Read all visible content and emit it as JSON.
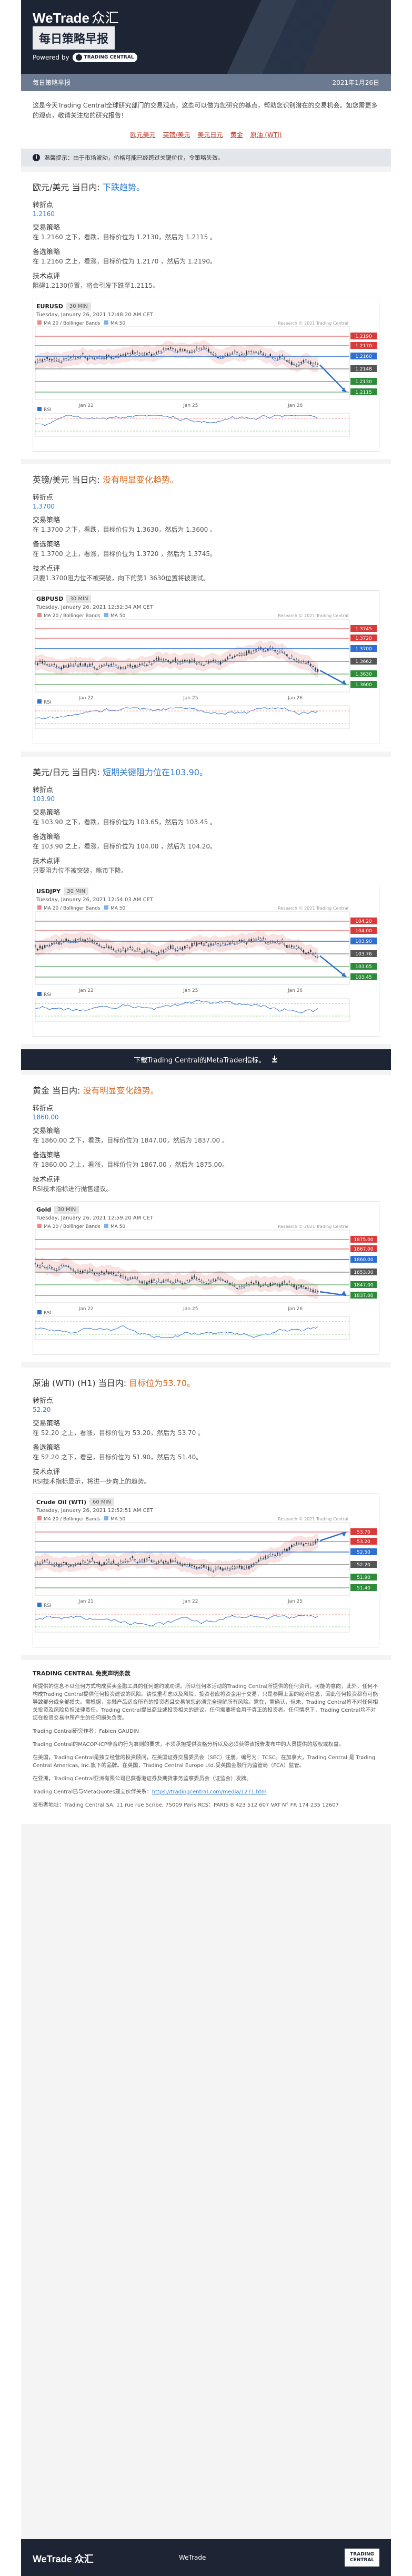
{
  "header": {
    "brand": "WeTrade",
    "brand_zh": "众汇",
    "title": "每日策略早报",
    "powered_by": "Powered by",
    "tc_logo": "TRADING CENTRAL"
  },
  "datebar": {
    "left": "每日策略早报",
    "right": "2021年1月26日"
  },
  "intro": {
    "text": "这是今天Trading Central全球研究部门的交易观点，这些可以做为您研究的基点，帮助您识别潜在的交易机会。如您需更多的观点，敬请关注您的研究报告！",
    "links": [
      "欧元美元",
      "英镑/美元",
      "美元日元",
      "黄金",
      "原油 (WTI)"
    ]
  },
  "notice": {
    "text": "温馨提示：由于市场波动，价格可能已经跨过关键价位，令策略失效。"
  },
  "sections": [
    {
      "title": "欧元/美元 当日内: ",
      "title_hl": "下跌趋势。",
      "hl": "blue",
      "pivot_label": "转折点",
      "pivot": "1.2160",
      "strat_label": "交易策略",
      "strat": "在 1.2160 之下，看跌，目标价位为 1.2130，然后为 1.2115 。",
      "alt_label": "备选策略",
      "alt": "在 1.2160 之上，看涨，目标价位为 1.2170 ，然后为 1.2190。",
      "tech_label": "技术点评",
      "tech": "阻碍1.2130位置，将会引发下跌至1.2115。",
      "chart": {
        "symbol": "EURUSD",
        "tf": "30 MIN",
        "time": "Tuesday, January 26, 2021 12:48:20 AM CET",
        "legend": "MA 20 / Bollinger Bands",
        "ma": "MA 50",
        "copy": "Research © 2021 Trading Central",
        "levels": [
          "1.2190",
          "1.2170",
          "1.2160",
          "1.2148",
          "1.2130",
          "1.2115"
        ],
        "xlabels": [
          "Jan 22",
          "Jan 25",
          "Jan 26"
        ],
        "rsi": "RSI"
      }
    },
    {
      "title": "英镑/美元 当日内: ",
      "title_hl": "没有明显变化趋势。",
      "hl": "orange",
      "pivot_label": "转折点",
      "pivot": "1.3700",
      "strat_label": "交易策略",
      "strat": "在 1.3700 之下，看跌，目标价位为 1.3630，然后为 1.3600 。",
      "alt_label": "备选策略",
      "alt": "在 1.3700 之上，看涨，目标价位为 1.3720 ，然后为 1.3745。",
      "tech_label": "技术点评",
      "tech": "只要1.3700阻力位不被突破，向下的第1 3630位置将被测试。",
      "chart": {
        "symbol": "GBPUSD",
        "tf": "30 MIN",
        "time": "Tuesday, January 26, 2021 12:52:34 AM CET",
        "legend": "MA 20 / Bollinger Bands",
        "ma": "MA 50",
        "copy": "Research © 2021 Trading Central",
        "levels": [
          "1.3745",
          "1.3720",
          "1.3700",
          "1.3662",
          "1.3630",
          "1.3600"
        ],
        "xlabels": [
          "Jan 22",
          "Jan 25",
          "Jan 26"
        ],
        "rsi": "RSI"
      }
    },
    {
      "title": "美元/日元 当日内: ",
      "title_hl": "短期关键阻力位在103.90。",
      "hl": "blue",
      "pivot_label": "转折点",
      "pivot": "103.90",
      "strat_label": "交易策略",
      "strat": "在 103.90 之下，看跌，目标价位为 103.65，然后为 103.45 。",
      "alt_label": "备选策略",
      "alt": "在 103.90 之上，看涨，目标价位为 104.00 ，然后为 104.20。",
      "tech_label": "技术点评",
      "tech": "只要阻力位不被突破，熊市下降。",
      "chart": {
        "symbol": "USDJPY",
        "tf": "30 MIN",
        "time": "Tuesday, January 26, 2021 12:54:03 AM CET",
        "legend": "MA 20 / Bollinger Bands",
        "ma": "MA 50",
        "copy": "Research © 2021 Trading Central",
        "levels": [
          "104.20",
          "104.00",
          "103.90",
          "103.76",
          "103.65",
          "103.45"
        ],
        "xlabels": [
          "Jan 22",
          "Jan 25",
          "Jan 26"
        ],
        "rsi": "RSI"
      }
    }
  ],
  "download": {
    "text": "下载Trading Central的MetaTrader指标。"
  },
  "sections2": [
    {
      "title": "黄金 当日内: ",
      "title_hl": "没有明显变化趋势。",
      "hl": "orange",
      "pivot_label": "转折点",
      "pivot": "1860.00",
      "strat_label": "交易策略",
      "strat": "在 1860.00 之下，看跌，目标价位为 1847.00，然后为 1837.00 。",
      "alt_label": "备选策略",
      "alt": "在 1860.00 之上，看涨，目标价位为 1867.00 ，然后为 1875.00。",
      "tech_label": "技术点评",
      "tech": "RSI技术指标进行抛售建议。",
      "chart": {
        "symbol": "Gold",
        "tf": "30 MIN",
        "time": "Tuesday, January 26, 2021 12:59:20 AM CET",
        "legend": "MA 20 / Bollinger Bands",
        "ma": "MA 50",
        "copy": "Research © 2021 Trading Central",
        "levels": [
          "1875.00",
          "1867.00",
          "1860.00",
          "1853.00",
          "1847.00",
          "1837.00"
        ],
        "xlabels": [
          "Jan 22",
          "Jan 25",
          "Jan 26"
        ],
        "rsi": "RSI"
      }
    },
    {
      "title": "原油 (WTI) (H1) 当日内: ",
      "title_hl": "目标位为53.70。",
      "hl": "orange",
      "pivot_label": "转折点",
      "pivot": "52.20",
      "strat_label": "交易策略",
      "strat": "在 52.20 之上，看涨，目标价位为 53.20，然后为 53.70 。",
      "alt_label": "备选策略",
      "alt": "在 52.20 之下，看空，目标价位为 51.90，然后为 51.40。",
      "tech_label": "技术点评",
      "tech": "RSI技术指标显示，将进一步向上的趋势。",
      "chart": {
        "symbol": "Crude Oil (WTI)",
        "tf": "60 MIN",
        "time": "Tuesday, January 26, 2021 12:52:51 AM CET",
        "legend": "MA 20 / Bollinger Bands",
        "ma": "MA 50",
        "copy": "Research © 2021 Trading Central",
        "levels": [
          "53.70",
          "53.20",
          "52.50",
          "52.20",
          "51.90",
          "51.40"
        ],
        "xlabels": [
          "Jan 21",
          "Jan 22",
          "Jan 25"
        ],
        "rsi": "RSI"
      }
    }
  ],
  "disclaimer": {
    "title": "TRADING CENTRAL 免责声明条款",
    "p1": "所提供的信息不以任何方式构成买卖金融工具的任何邀约或劝诱。所以任何本活动的Trading Central所提供的任何资讯，可能的意向，此外，任何不构成Trading Central提供任何投资建议的风险。请慎重考虑以及风险，投资者应将资金用于交易，只是参照上面的经济信息，因此任何投资都有可能导致部分或全部损失。需根据，金融产品适合所有的投资者且交易前您必须完全理解所有风险。需在，需确认，但未，Trading Central将不对任何相关投资及风险负担法律责任。Trading Central提出商业或投资相关的建议，任何需要将会用于真正的投资者。任何情况下，Trading Central均不对您在投资交易中所产生的任何损失负责。",
    "p2": "Trading Central研究作者：Fabien GAUDIN",
    "p3": "Trading Central的MACOP-ICP非合约行为准则的要求，不须承担提供资格分析以及必须获得该报告发布中的人员提供的版权或权益。",
    "p4": "在美国，Trading Central是独立经营的投资顾问，在美国证券交易委员会（SEC）注册。编号为：TCSC。在加拿大，Trading Central 是 Trading Central Americas, Inc.旗下的品牌。在英国，Trading Central Europe Ltd.受英国金融行为监管局（FCA）监管。",
    "p5": "在亚洲，Trading Central亚洲有限公司已获香港证券及期货事务监察委员会（证监会）发牌。",
    "p6_prefix": "Trading Central已与MetaQuotes建立伙伴关系：",
    "p6_link": "https://tradingcentral.com/media/1271.htm",
    "p7": "发布者地址：Trading Central SA, 11 rue rue Scribe, 75009 Paris  RCS：PARIS B 423 512 607 VAT N° FR 174 235 12607"
  },
  "footer": {
    "left": "WeTrade",
    "left_zh": "众汇",
    "mid": "WeTrade",
    "right": "TRADING CENTRAL"
  }
}
